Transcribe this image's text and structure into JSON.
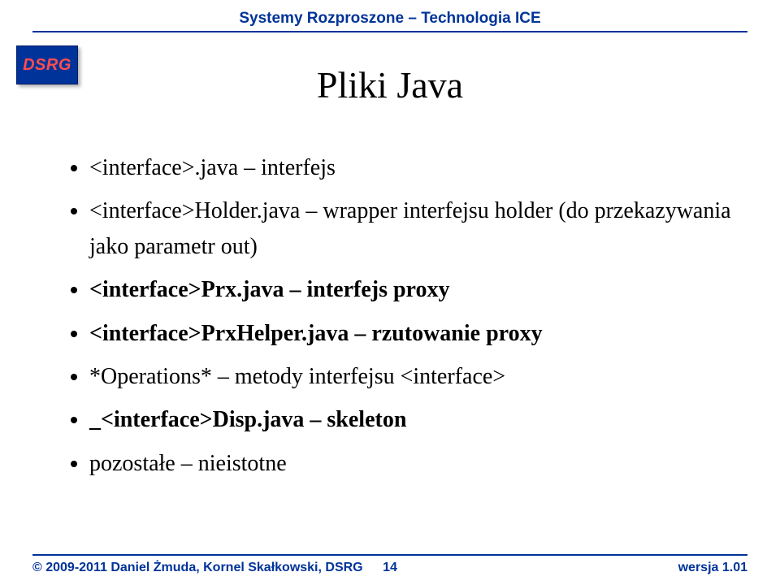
{
  "header": {
    "text": "Systemy Rozproszone – Technologia ICE"
  },
  "badge": "DSRG",
  "title": "Pliki Java",
  "bullets": [
    {
      "pre": "<interface>.java",
      "rest": " – interfejs",
      "bold": false
    },
    {
      "pre": "<interface>Holder.java",
      "rest": " – wrapper interfejsu holder (do przekazywania jako parametr out)",
      "bold": false
    },
    {
      "pre": "<interface>Prx.java – interfejs proxy",
      "rest": "",
      "bold": true
    },
    {
      "pre": "<interface>PrxHelper.java – rzutowanie proxy",
      "rest": "",
      "bold": true
    },
    {
      "pre": "*Operations*",
      "rest": " – metody interfejsu <interface>",
      "bold": false
    },
    {
      "pre": "_<interface>Disp.java – skeleton",
      "rest": "",
      "bold": true
    },
    {
      "pre": "pozostałe",
      "rest": " – nieistotne",
      "bold": false
    }
  ],
  "footer": {
    "left": "© 2009-2011 Daniel Żmuda, Kornel Skałkowski, DSRG",
    "center": "14",
    "right": "wersja 1.01"
  }
}
